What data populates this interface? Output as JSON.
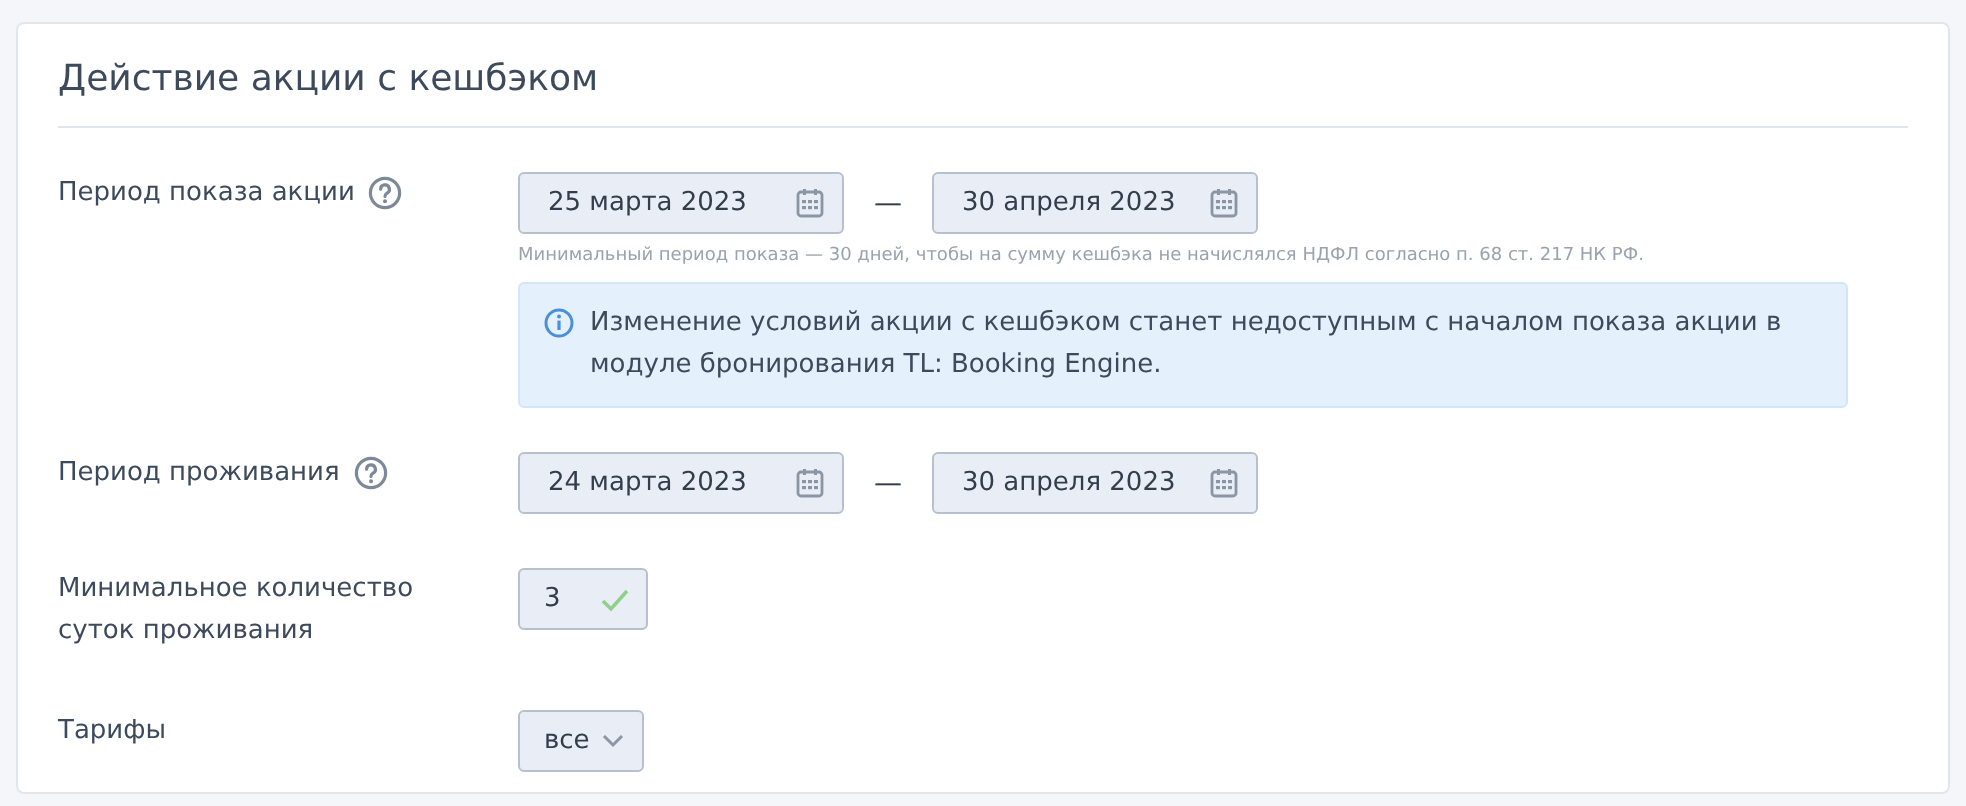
{
  "card": {
    "title": "Действие акции с кешбэком",
    "rows": [
      {
        "kind": "date_range",
        "label": "Период показа акции",
        "help_icon": true,
        "from": "25 марта 2023",
        "to": "30 апреля 2023",
        "separator": "—",
        "hint": "Минимальный период показа — 30 дней, чтобы на сумму кешбэка не начислялся НДФЛ согласно п. 68 ст. 217 НК РФ.",
        "notice": "Изменение условий акции с кешбэком станет недоступным с началом показа акции в модуле бронирования TL: Booking Engine."
      },
      {
        "kind": "date_range",
        "label": "Период проживания",
        "help_icon": true,
        "from": "24 марта 2023",
        "to": "30 апреля 2023",
        "separator": "—"
      },
      {
        "kind": "number",
        "label": "Минимальное количество суток проживания",
        "help_icon": false,
        "value": "3",
        "valid": true
      },
      {
        "kind": "select",
        "label": "Тарифы",
        "help_icon": false,
        "value": "все"
      }
    ]
  }
}
